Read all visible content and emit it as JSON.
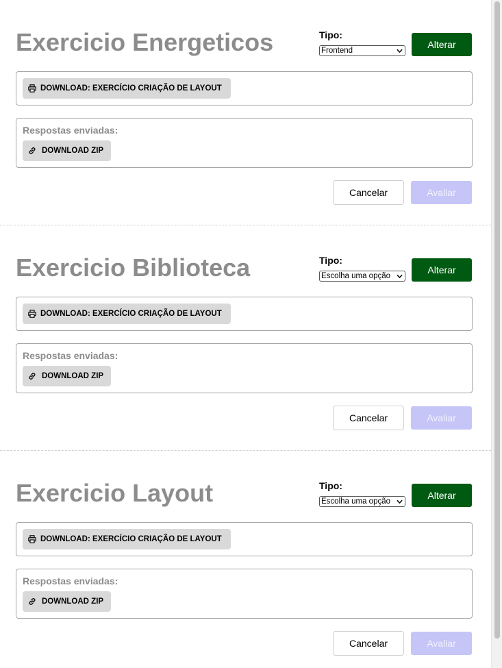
{
  "exercises": [
    {
      "title": "Exercicio Energeticos",
      "tipo_label": "Tipo:",
      "tipo_selected": "Frontend",
      "alterar_label": "Alterar",
      "download_label": "DOWNLOAD: EXERCÍCIO CRIAÇÃO DE LAYOUT",
      "responses_label": "Respostas enviadas:",
      "zip_label": "DOWNLOAD ZIP",
      "cancel_label": "Cancelar",
      "evaluate_label": "Avaliar"
    },
    {
      "title": "Exercicio Biblioteca",
      "tipo_label": "Tipo:",
      "tipo_selected": "Escolha uma opção",
      "alterar_label": "Alterar",
      "download_label": "DOWNLOAD: EXERCÍCIO CRIAÇÃO DE LAYOUT",
      "responses_label": "Respostas enviadas:",
      "zip_label": "DOWNLOAD ZIP",
      "cancel_label": "Cancelar",
      "evaluate_label": "Avaliar"
    },
    {
      "title": "Exercicio Layout",
      "tipo_label": "Tipo:",
      "tipo_selected": "Escolha uma opção",
      "alterar_label": "Alterar",
      "download_label": "DOWNLOAD: EXERCÍCIO CRIAÇÃO DE LAYOUT",
      "responses_label": "Respostas enviadas:",
      "zip_label": "DOWNLOAD ZIP",
      "cancel_label": "Cancelar",
      "evaluate_label": "Avaliar"
    }
  ],
  "icons": {
    "download": "printer-icon",
    "zip": "link-icon",
    "select": "chevron-down-icon"
  },
  "colors": {
    "title_gray": "#8c8c8c",
    "alterar_green": "#005a12",
    "avaliar_disabled": "#c5c5f7",
    "chip_gray": "#d9d9d9"
  }
}
